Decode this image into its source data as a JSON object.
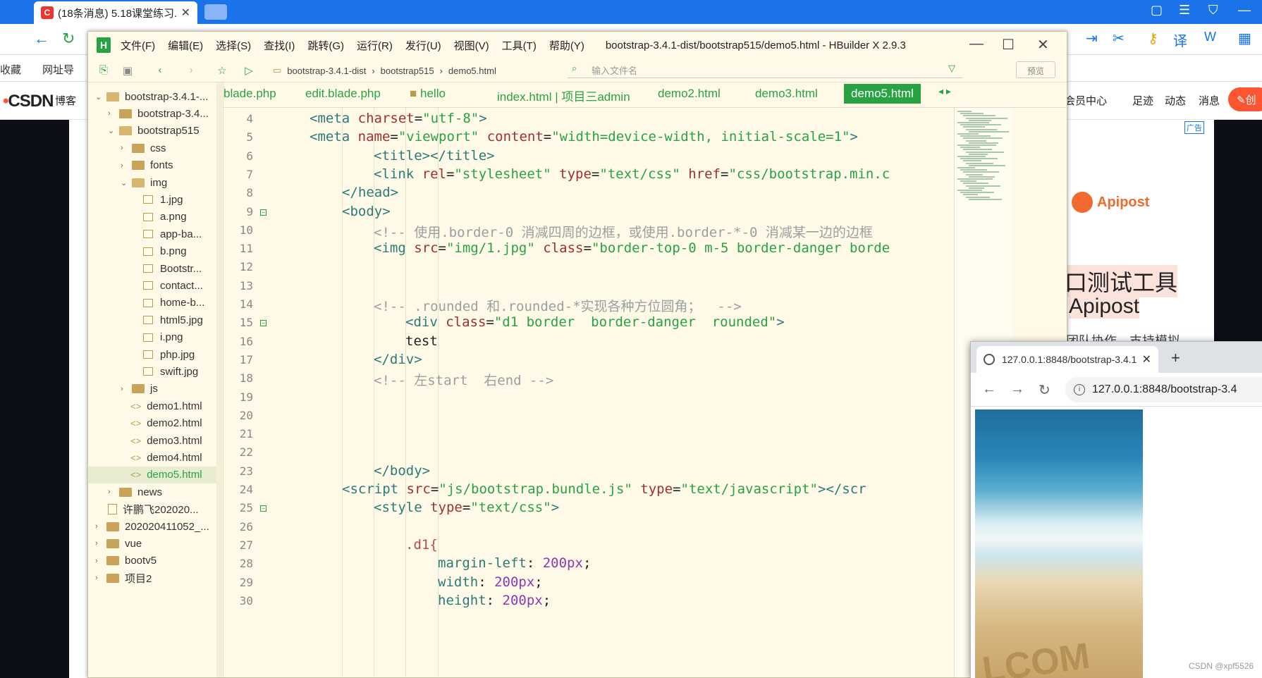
{
  "browser": {
    "tab_title": "(18条消息) 5.18课堂练习...",
    "bookmarks_label": "收藏",
    "bookmark_web": "网址导"
  },
  "csdn": {
    "logo": "CSDN",
    "nav_blog": "博客",
    "nav_member": "会员中心",
    "nav_footprint": "足迹",
    "nav_dynamic": "动态",
    "nav_messages": "消息",
    "create_label": "创"
  },
  "ad": {
    "label": "广告",
    "brand": "Apipost",
    "title": "口测试工具",
    "subtitle": "Apipost",
    "desc": "团队协作，支持模拟"
  },
  "hbuilder": {
    "logo": "H",
    "menu": [
      "文件(F)",
      "编辑(E)",
      "选择(S)",
      "查找(I)",
      "跳转(G)",
      "运行(R)",
      "发行(U)",
      "视图(V)",
      "工具(T)",
      "帮助(Y)"
    ],
    "title": "bootstrap-3.4.1-dist/bootstrap515/demo5.html - HBuilder X 2.9.3",
    "path": [
      "bootstrap-3.4.1-dist",
      "bootstrap515",
      "demo5.html"
    ],
    "file_input_placeholder": "输入文件名",
    "preview_label": "预览",
    "tabs": [
      "blade.php",
      "edit.blade.php",
      "hello",
      "index.html | 项目三admin",
      "demo2.html",
      "demo3.html",
      "demo5.html"
    ],
    "active_tab": "demo5.html",
    "tree": [
      {
        "label": "bootstrap-3.4.1-...",
        "type": "folder",
        "open": true
      },
      {
        "label": "bootstrap-3.4...",
        "type": "folder",
        "open": false
      },
      {
        "label": "bootstrap515",
        "type": "folder",
        "open": true
      },
      {
        "label": "css",
        "type": "folder",
        "open": false
      },
      {
        "label": "fonts",
        "type": "folder",
        "open": false
      },
      {
        "label": "img",
        "type": "folder",
        "open": true
      },
      {
        "label": "1.jpg",
        "type": "image"
      },
      {
        "label": "a.png",
        "type": "image"
      },
      {
        "label": "app-ba...",
        "type": "image"
      },
      {
        "label": "b.png",
        "type": "image"
      },
      {
        "label": "Bootstr...",
        "type": "image"
      },
      {
        "label": "contact...",
        "type": "image"
      },
      {
        "label": "home-b...",
        "type": "image"
      },
      {
        "label": "html5.jpg",
        "type": "image"
      },
      {
        "label": "i.png",
        "type": "image"
      },
      {
        "label": "php.jpg",
        "type": "image"
      },
      {
        "label": "swift.jpg",
        "type": "image"
      },
      {
        "label": "js",
        "type": "folder",
        "open": false
      },
      {
        "label": "demo1.html",
        "type": "html"
      },
      {
        "label": "demo2.html",
        "type": "html"
      },
      {
        "label": "demo3.html",
        "type": "html"
      },
      {
        "label": "demo4.html",
        "type": "html"
      },
      {
        "label": "demo5.html",
        "type": "html",
        "active": true
      },
      {
        "label": "news",
        "type": "folder",
        "open": false
      },
      {
        "label": "许鹏飞202020...",
        "type": "file"
      },
      {
        "label": "202020411052_...",
        "type": "folder",
        "open": false
      },
      {
        "label": "vue",
        "type": "folder",
        "open": false
      },
      {
        "label": "bootv5",
        "type": "folder",
        "open": false
      },
      {
        "label": "项目2",
        "type": "folder",
        "open": false
      }
    ],
    "line_numbers": [
      "4",
      "5",
      "6",
      "7",
      "8",
      "9",
      "10",
      "11",
      "12",
      "13",
      "14",
      "15",
      "16",
      "17",
      "18",
      "19",
      "20",
      "21",
      "22",
      "23",
      "24",
      "25",
      "26",
      "27",
      "28",
      "29",
      "30"
    ],
    "code": {
      "l4": [
        "<meta ",
        "charset",
        "=",
        "\"utf-8\"",
        ">"
      ],
      "l5": [
        "<meta ",
        "name",
        "=",
        "\"viewport\"",
        " ",
        "content",
        "=",
        "\"width=device-width, initial-scale=1\"",
        ">"
      ],
      "l6": [
        "<title></title>"
      ],
      "l7": [
        "<link ",
        "rel",
        "=",
        "\"stylesheet\"",
        " ",
        "type",
        "=",
        "\"text/css\"",
        " ",
        "href",
        "=",
        "\"css/bootstrap.min.c"
      ],
      "l8": [
        "</head>"
      ],
      "l9": [
        "<body>"
      ],
      "l10": [
        "<!-- 使用.border-0 消减四周的边框，或使用.border-*-0 消减某一边的边框"
      ],
      "l11": [
        "<img ",
        "src",
        "=",
        "\"img/1.jpg\"",
        " ",
        "class",
        "=",
        "\"border-top-0 m-5 border-danger borde"
      ],
      "l14": [
        "<!-- .rounded 和.rounded-*实现各种方位圆角；  -->"
      ],
      "l15": [
        "<div ",
        "class",
        "=",
        "\"d1 border  border-danger  rounded\"",
        ">"
      ],
      "l16": [
        "test"
      ],
      "l17": [
        "</div>"
      ],
      "l18": [
        "<!-- 左start  右end -->"
      ],
      "l23": [
        "</body>"
      ],
      "l24": [
        "<script ",
        "src",
        "=",
        "\"js/bootstrap.bundle.js\"",
        " ",
        "type",
        "=",
        "\"text/javascript\"",
        "></scr"
      ],
      "l25": [
        "<style ",
        "type",
        "=",
        "\"text/css\"",
        ">"
      ],
      "l27": [
        ".d1{"
      ],
      "l28": [
        "margin-left",
        ": ",
        "200px",
        ";"
      ],
      "l29": [
        "width",
        ": ",
        "200px",
        ";"
      ],
      "l30": [
        "height",
        ": ",
        "200px",
        ";"
      ]
    }
  },
  "popup": {
    "tab_title": "127.0.0.1:8848/bootstrap-3.4.1",
    "url": "127.0.0.1:8848/bootstrap-3.4",
    "image_text": "LCOM"
  },
  "watermark": "CSDN @xpf5526",
  "colors": {
    "accent": "#27a344",
    "editor_bg": "#fffae8",
    "csdn_red": "#fc5531",
    "chrome_blue": "#1a73e8"
  }
}
